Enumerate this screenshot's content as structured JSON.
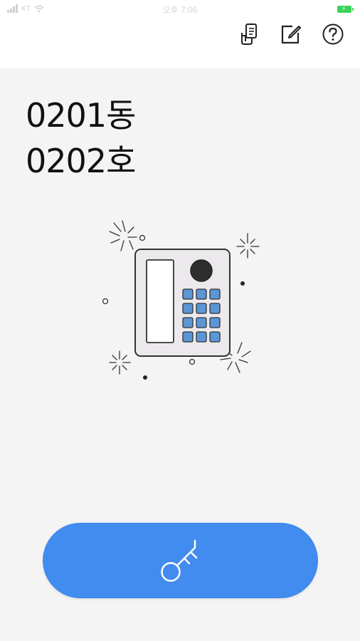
{
  "status_bar": {
    "carrier": "KT",
    "time": "오후 7:06"
  },
  "header": {
    "icons": [
      "history-icon",
      "edit-icon",
      "help-icon"
    ]
  },
  "apartment": {
    "dong": "0201동",
    "ho": "0202호"
  },
  "illustration": {
    "subject": "intercom-keypad-illustration"
  },
  "open_button": {
    "icon": "key-icon",
    "color": "#428bef"
  },
  "colors": {
    "accent": "#428bef",
    "keypad": "#5b96d6",
    "battery": "#3ad35a"
  }
}
